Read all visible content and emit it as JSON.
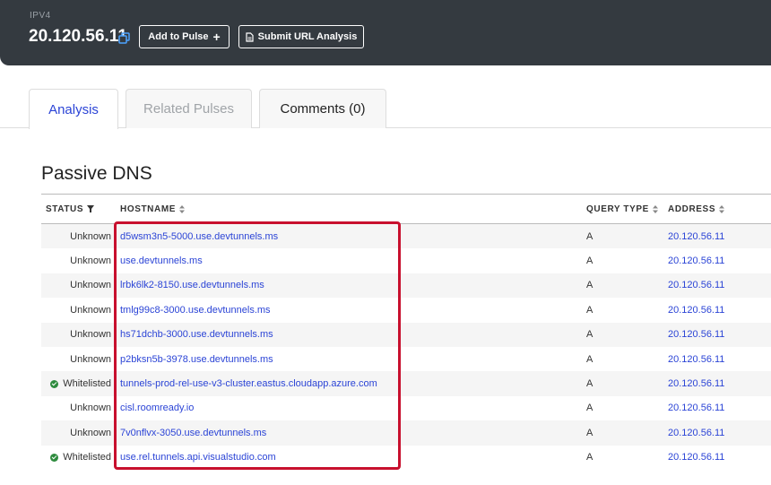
{
  "header": {
    "type_label": "IPV4",
    "ip": "20.120.56.11",
    "add_to_pulse_label": "Add to Pulse",
    "add_to_pulse_icon": "+",
    "submit_url_label": "Submit URL Analysis"
  },
  "tabs": [
    {
      "label": "Analysis",
      "active": true
    },
    {
      "label": "Related Pulses",
      "active": false
    },
    {
      "label": "Comments (0)",
      "active": false
    }
  ],
  "section_title": "Passive DNS",
  "table": {
    "columns": {
      "status": "STATUS",
      "hostname": "HOSTNAME",
      "query_type": "QUERY TYPE",
      "address": "ADDRESS"
    },
    "rows": [
      {
        "status": "Unknown",
        "whitelisted": false,
        "hostname": "d5wsm3n5-5000.use.devtunnels.ms",
        "query_type": "A",
        "address": "20.120.56.11"
      },
      {
        "status": "Unknown",
        "whitelisted": false,
        "hostname": "use.devtunnels.ms",
        "query_type": "A",
        "address": "20.120.56.11"
      },
      {
        "status": "Unknown",
        "whitelisted": false,
        "hostname": "lrbk6lk2-8150.use.devtunnels.ms",
        "query_type": "A",
        "address": "20.120.56.11"
      },
      {
        "status": "Unknown",
        "whitelisted": false,
        "hostname": "tmlg99c8-3000.use.devtunnels.ms",
        "query_type": "A",
        "address": "20.120.56.11"
      },
      {
        "status": "Unknown",
        "whitelisted": false,
        "hostname": "hs71dchb-3000.use.devtunnels.ms",
        "query_type": "A",
        "address": "20.120.56.11"
      },
      {
        "status": "Unknown",
        "whitelisted": false,
        "hostname": "p2bksn5b-3978.use.devtunnels.ms",
        "query_type": "A",
        "address": "20.120.56.11"
      },
      {
        "status": "Whitelisted",
        "whitelisted": true,
        "hostname": "tunnels-prod-rel-use-v3-cluster.eastus.cloudapp.azure.com",
        "query_type": "A",
        "address": "20.120.56.11"
      },
      {
        "status": "Unknown",
        "whitelisted": false,
        "hostname": "cisl.roomready.io",
        "query_type": "A",
        "address": "20.120.56.11"
      },
      {
        "status": "Unknown",
        "whitelisted": false,
        "hostname": "7v0nflvx-3050.use.devtunnels.ms",
        "query_type": "A",
        "address": "20.120.56.11"
      },
      {
        "status": "Whitelisted",
        "whitelisted": true,
        "hostname": "use.rel.tunnels.api.visualstudio.com",
        "query_type": "A",
        "address": "20.120.56.11"
      }
    ]
  },
  "colors": {
    "header_bg": "#343a40",
    "link": "#2b44d6",
    "highlight_border": "#c8102e",
    "whitelisted_check": "#2e8b3e"
  }
}
